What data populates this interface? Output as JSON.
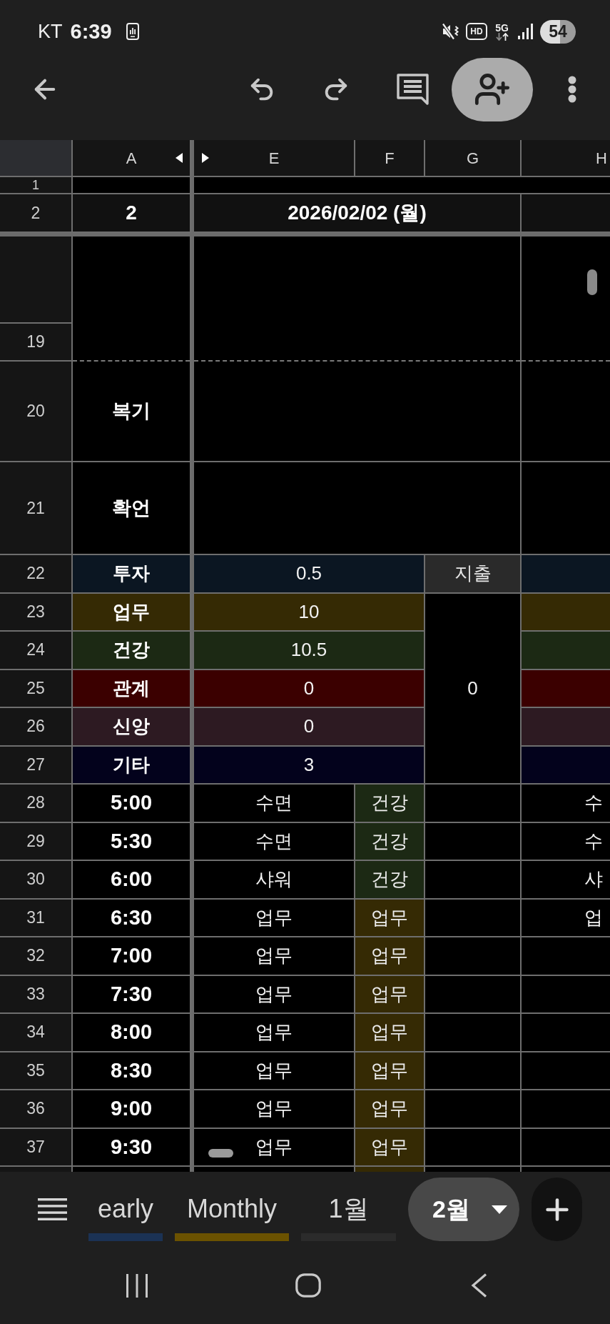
{
  "status_bar": {
    "carrier": "KT",
    "time": "6:39",
    "hd": "HD",
    "network": "5G",
    "battery": "54"
  },
  "sheet": {
    "column_headers": [
      "A",
      "E",
      "F",
      "G",
      "H"
    ],
    "row_1": {
      "number": "1"
    },
    "row_2": {
      "number": "2",
      "col_a": "2",
      "date": "2026/02/02 (월)"
    },
    "note_rows": [
      {
        "number": "19"
      },
      {
        "number": "20",
        "label": "복기"
      },
      {
        "number": "21",
        "label": "확언"
      }
    ],
    "summary_rows": [
      {
        "number": "22",
        "label": "투자",
        "value": "0.5",
        "color": "#0b1622"
      },
      {
        "number": "23",
        "label": "업무",
        "value": "10",
        "color": "#352a04"
      },
      {
        "number": "24",
        "label": "건강",
        "value": "10.5",
        "color": "#1c2914"
      },
      {
        "number": "25",
        "label": "관계",
        "value": "0",
        "color": "#3b0000"
      },
      {
        "number": "26",
        "label": "신앙",
        "value": "0",
        "color": "#2d1a22"
      },
      {
        "number": "27",
        "label": "기타",
        "value": "3",
        "color": "#03021c"
      }
    ],
    "expense": {
      "label": "지출",
      "value": "0"
    },
    "schedule_rows": [
      {
        "number": "28",
        "time": "5:00",
        "activity": "수면",
        "category": "건강",
        "color": "#1c2914",
        "col_h": "수"
      },
      {
        "number": "29",
        "time": "5:30",
        "activity": "수면",
        "category": "건강",
        "color": "#1c2914",
        "col_h": "수"
      },
      {
        "number": "30",
        "time": "6:00",
        "activity": "샤워",
        "category": "건강",
        "color": "#1c2914",
        "col_h": "샤"
      },
      {
        "number": "31",
        "time": "6:30",
        "activity": "업무",
        "category": "업무",
        "color": "#352a04",
        "col_h": "업"
      },
      {
        "number": "32",
        "time": "7:00",
        "activity": "업무",
        "category": "업무",
        "color": "#352a04"
      },
      {
        "number": "33",
        "time": "7:30",
        "activity": "업무",
        "category": "업무",
        "color": "#352a04"
      },
      {
        "number": "34",
        "time": "8:00",
        "activity": "업무",
        "category": "업무",
        "color": "#352a04"
      },
      {
        "number": "35",
        "time": "8:30",
        "activity": "업무",
        "category": "업무",
        "color": "#352a04"
      },
      {
        "number": "36",
        "time": "9:00",
        "activity": "업무",
        "category": "업무",
        "color": "#352a04"
      },
      {
        "number": "37",
        "time": "9:30",
        "activity": "업무",
        "category": "업무",
        "color": "#352a04"
      }
    ],
    "partial_row": {
      "color": "#352a04"
    }
  },
  "sheet_tabs": [
    {
      "label": "early",
      "color": "#1b3254",
      "selected": false
    },
    {
      "label": "Monthly",
      "color": "#6b5200",
      "selected": false
    },
    {
      "label": "1월",
      "color": "#2b2b2b",
      "selected": false
    },
    {
      "label": "2월",
      "selected": true
    }
  ]
}
